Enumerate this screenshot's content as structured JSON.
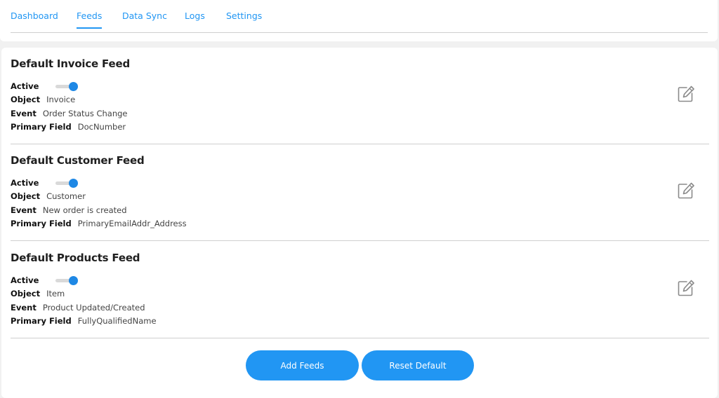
{
  "nav": {
    "tabs": [
      {
        "label": "Dashboard"
      },
      {
        "label": "Feeds",
        "active": true
      },
      {
        "label": "Data Sync"
      },
      {
        "label": "Logs"
      },
      {
        "label": "Settings"
      }
    ]
  },
  "field_labels": {
    "active": "Active",
    "object": "Object",
    "event": "Event",
    "primary_field": "Primary Field"
  },
  "feeds": [
    {
      "title": "Default Invoice Feed",
      "active": true,
      "object": "Invoice",
      "event": "Order Status Change",
      "primary_field": "DocNumber",
      "edit_icon": "edit-icon"
    },
    {
      "title": "Default Customer Feed",
      "active": true,
      "object": "Customer",
      "event": "New order is created",
      "primary_field": "PrimaryEmailAddr_Address",
      "edit_icon": "edit-icon"
    },
    {
      "title": "Default Products Feed",
      "active": true,
      "object": "Item",
      "event": "Product Updated/Created",
      "primary_field": "FullyQualifiedName",
      "edit_icon": "edit-icon"
    }
  ],
  "actions": {
    "add_feeds": "Add Feeds",
    "reset_default": "Reset Default"
  },
  "colors": {
    "accent": "#2196f3",
    "toggle_on": "#1e88e5",
    "background": "#f1f1f1"
  }
}
